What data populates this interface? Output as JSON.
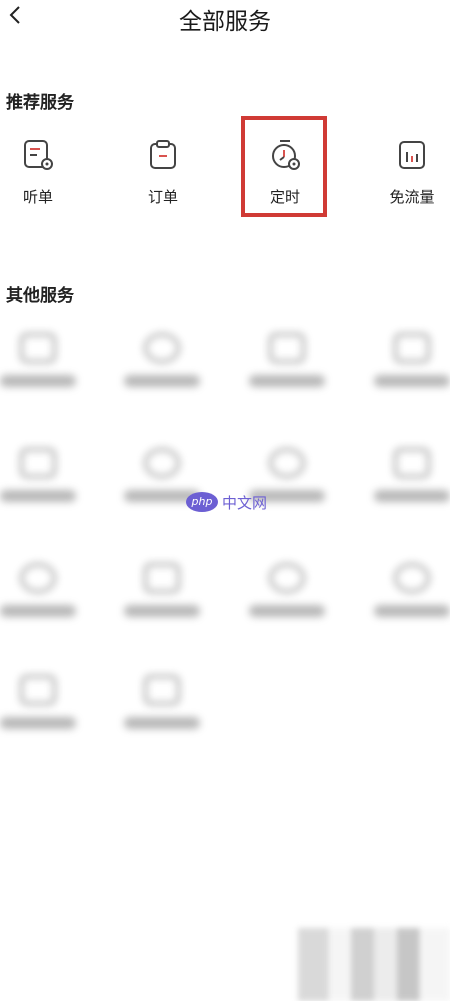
{
  "header": {
    "title": "全部服务"
  },
  "recommended": {
    "title": "推荐服务",
    "items": [
      {
        "label": "听单",
        "icon": "playlist-icon"
      },
      {
        "label": "订单",
        "icon": "clipboard-icon"
      },
      {
        "label": "定时",
        "icon": "timer-icon",
        "highlighted": true
      },
      {
        "label": "免流量",
        "icon": "data-traffic-icon"
      }
    ]
  },
  "other": {
    "title": "其他服务"
  },
  "watermark": {
    "logo": "php",
    "text": "中文网"
  },
  "colors": {
    "highlight": "#d03a35",
    "icon_stroke": "#444444",
    "accent_dot": "#d9534f"
  }
}
